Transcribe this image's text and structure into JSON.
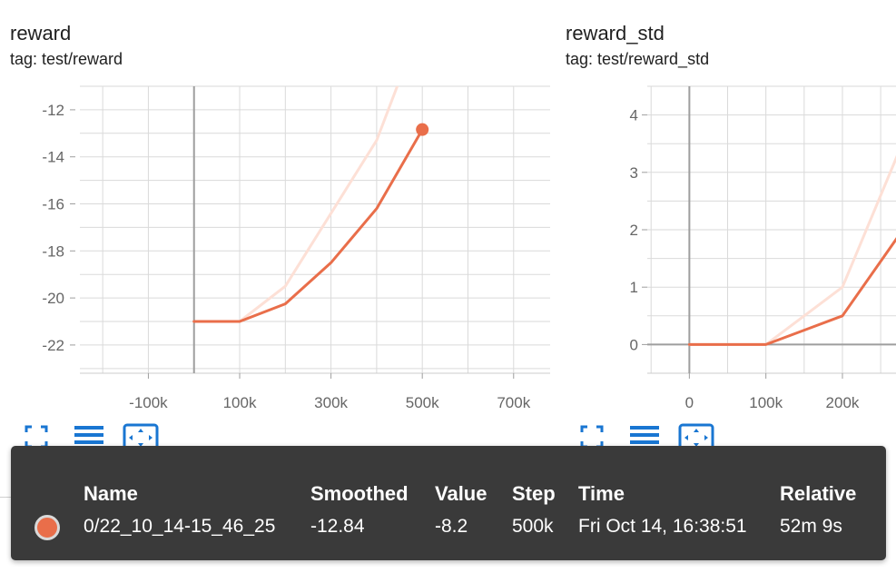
{
  "cards": [
    {
      "title": "reward",
      "tag": "tag: test/reward"
    },
    {
      "title": "reward_std",
      "tag": "tag: test/reward_std"
    }
  ],
  "icons": [
    "fullscreen-icon",
    "toggle-log-scale-icon",
    "fit-domain-icon"
  ],
  "colors": {
    "run": "#e96e4a",
    "raw_line": "#fde0d6",
    "tooltip_bg": "#3a3a3a",
    "axis": "#9e9e9e"
  },
  "chart_data": [
    {
      "type": "line",
      "title": "reward",
      "subtitle": "tag: test/reward",
      "xlim": [
        -250000,
        780000
      ],
      "ylim": [
        -23.2,
        -11
      ],
      "x_ticks": [
        -100000,
        100000,
        300000,
        500000,
        700000
      ],
      "x_tick_labels": [
        "-100k",
        "100k",
        "300k",
        "500k",
        "700k"
      ],
      "y_ticks": [
        -12,
        -14,
        -16,
        -18,
        -20,
        -22
      ],
      "y_tick_labels": [
        "-12",
        "-14",
        "-16",
        "-18",
        "-20",
        "-22"
      ],
      "grid": true,
      "series": [
        {
          "name": "0/22_10_14-15_46_25",
          "kind": "raw",
          "x": [
            0,
            100000,
            200000,
            300000,
            400000,
            500000
          ],
          "y": [
            -21.0,
            -21.0,
            -19.5,
            -16.4,
            -13.3,
            -8.2
          ]
        },
        {
          "name": "0/22_10_14-15_46_25",
          "kind": "smoothed",
          "x": [
            0,
            100000,
            200000,
            300000,
            400000,
            500000
          ],
          "y": [
            -21.0,
            -21.0,
            -20.25,
            -18.5,
            -16.2,
            -12.84
          ]
        }
      ],
      "highlight_point": {
        "x": 500000,
        "y": -12.84
      }
    },
    {
      "type": "line",
      "title": "reward_std",
      "subtitle": "tag: test/reward_std",
      "xlim": [
        -55000,
        270000
      ],
      "ylim": [
        -0.5,
        4.5
      ],
      "x_ticks": [
        0,
        100000,
        200000
      ],
      "x_tick_labels": [
        "0",
        "100k",
        "200k"
      ],
      "y_ticks": [
        0,
        1,
        2,
        3,
        4
      ],
      "y_tick_labels": [
        "0",
        "1",
        "2",
        "3",
        "4"
      ],
      "grid": true,
      "series": [
        {
          "name": "0/22_10_14-15_46_25",
          "kind": "raw",
          "x": [
            0,
            100000,
            200000,
            300000
          ],
          "y": [
            0,
            0,
            1.0,
            4.2
          ]
        },
        {
          "name": "0/22_10_14-15_46_25",
          "kind": "smoothed",
          "x": [
            0,
            100000,
            200000,
            300000
          ],
          "y": [
            0,
            0,
            0.5,
            2.4
          ]
        }
      ]
    }
  ],
  "tooltip": {
    "headers": {
      "name": "Name",
      "smoothed": "Smoothed",
      "value": "Value",
      "step": "Step",
      "time": "Time",
      "relative": "Relative"
    },
    "row": {
      "name": "0/22_10_14-15_46_25",
      "smoothed": "-12.84",
      "value": "-8.2",
      "step": "500k",
      "time": "Fri Oct 14, 16:38:51",
      "relative": "52m 9s"
    }
  }
}
